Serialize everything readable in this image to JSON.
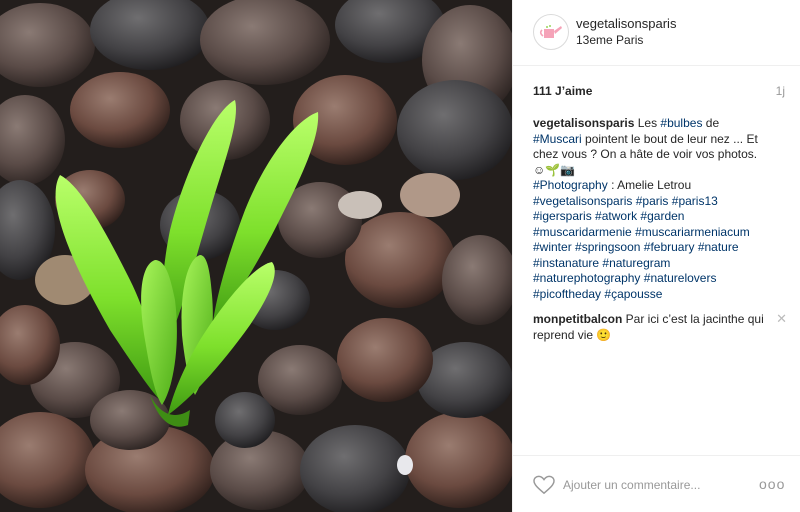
{
  "post": {
    "username": "vegetalisonsparis",
    "location": "13eme Paris",
    "likes": "111 J’aime",
    "time": "1j"
  },
  "caption": {
    "user": "vegetalisonsparis",
    "t1": " Les ",
    "h_bulbes": "#bulbes",
    "t2": " de ",
    "h_muscari": "#Muscari",
    "t3": " pointent le bout de leur nez ... Et chez vous ? On a hâte de voir vos photos. ",
    "emoji": "☺🌱📷",
    "h_photography": "#Photography",
    "t4": " : Amelie Letrou",
    "tags": [
      "#vegetalisonsparis",
      "#paris",
      "#paris13",
      "#igersparis",
      "#atwork",
      "#garden",
      "#muscaridarmenie",
      "#muscariarmeniacum",
      "#winter",
      "#springsoon",
      "#february",
      "#nature",
      "#instanature",
      "#naturegram",
      "#naturephotography",
      "#naturelovers",
      "#picoftheday",
      "#çapousse"
    ]
  },
  "comment2": {
    "user": "monpetitbalcon",
    "text": " Par ici c’est la jacinthe qui reprend vie 🙂",
    "close": "✕"
  },
  "footer": {
    "placeholder": "Ajouter un commentaire...",
    "more": "ooo"
  },
  "icons": {
    "heart": "heart-icon",
    "avatar": "watering-can-icon",
    "more": "more-options-icon"
  },
  "colors": {
    "hashtag": "#003569",
    "muted": "#999999",
    "border": "#efefef",
    "sprout": "#8ee63a"
  }
}
